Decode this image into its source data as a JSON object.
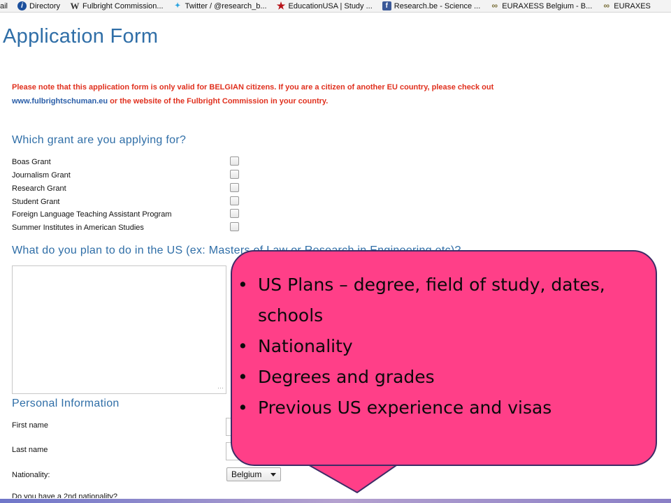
{
  "bookmarks": [
    {
      "icon": "mail-icon",
      "label": "ail"
    },
    {
      "icon": "directory-icon",
      "label": "Directory"
    },
    {
      "icon": "wikipedia-icon",
      "label": "Fulbright Commission..."
    },
    {
      "icon": "twitter-icon",
      "label": "Twitter / @research_b..."
    },
    {
      "icon": "star-icon",
      "label": "EducationUSA | Study ..."
    },
    {
      "icon": "facebook-icon",
      "label": "Research.be - Science ..."
    },
    {
      "icon": "euraxess-icon",
      "label": "EURAXESS Belgium - B..."
    },
    {
      "icon": "euraxess-icon",
      "label": "EURAXES"
    }
  ],
  "page": {
    "title": "Application Form",
    "notice_text": "Please note that this application form is only valid for BELGIAN citizens. If you are a citizen of another EU country, please check out",
    "notice_link": "www.fulbrightschuman.eu",
    "notice_tail": "or the website of the Fulbright Commission in your country."
  },
  "grant": {
    "heading": "Which grant are you applying for?",
    "options": [
      {
        "label": "Boas Grant",
        "checked": false
      },
      {
        "label": "Journalism Grant",
        "checked": false
      },
      {
        "label": "Research Grant",
        "checked": false
      },
      {
        "label": "Student Grant",
        "checked": false
      },
      {
        "label": "Foreign Language Teaching Assistant Program",
        "checked": false
      },
      {
        "label": "Summer Institutes in American Studies",
        "checked": false
      }
    ]
  },
  "plans": {
    "heading": "What do you plan to do in the US (ex: Masters of Law or Research in Engineering etc)?"
  },
  "personal": {
    "heading": "Personal Information",
    "first_name_label": "First name",
    "last_name_label": "Last name",
    "nationality_label": "Nationality:",
    "nationality_value": "Belgium",
    "next_label": "Do you have a 2nd nationality?"
  },
  "callout": {
    "color": "#ff3f88",
    "border_color": "#3d2c66",
    "bullets": [
      "US Plans – degree, field of study, dates, schools",
      "Nationality",
      "Degrees and grades",
      "Previous US experience and visas"
    ]
  }
}
